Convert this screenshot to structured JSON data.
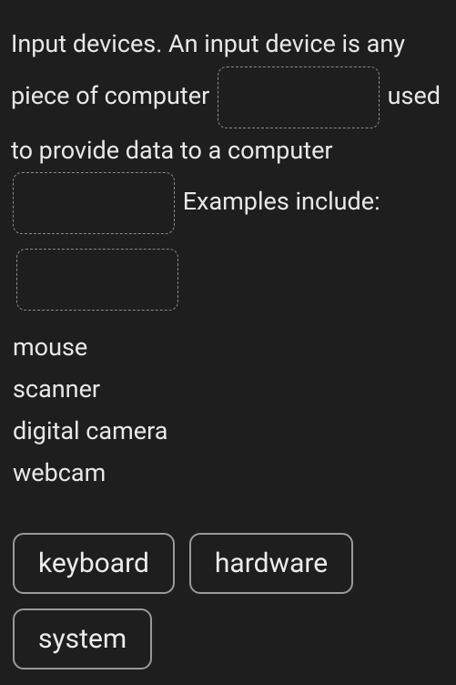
{
  "paragraph": {
    "chunk1": " Input devices. An input device is any piece of computer ",
    "chunk2": " used to provide data to a computer ",
    "chunk3": " Examples include:"
  },
  "list": {
    "items": [
      "mouse",
      "scanner",
      "digital camera",
      "webcam"
    ]
  },
  "wordBank": {
    "options": [
      "keyboard",
      "hardware",
      "system"
    ]
  }
}
